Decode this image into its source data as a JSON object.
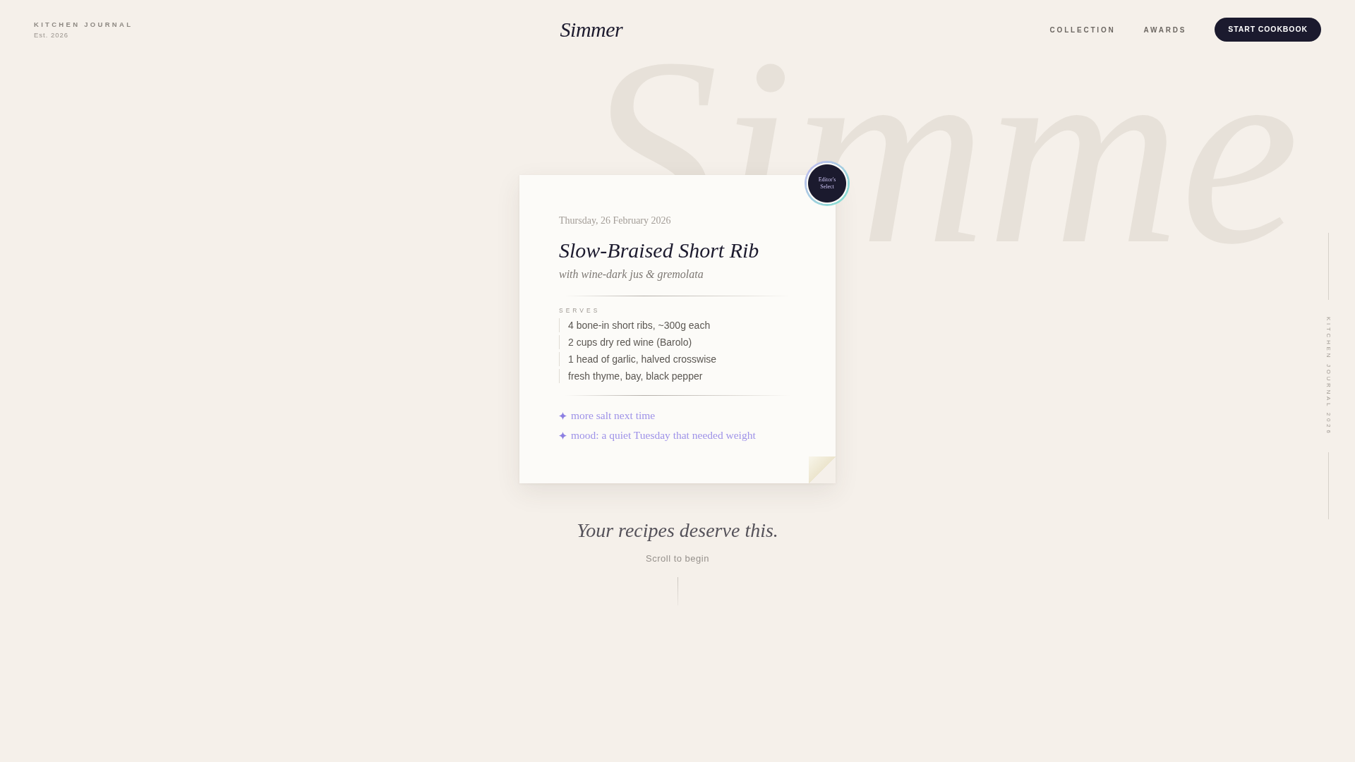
{
  "header": {
    "brand": "KITCHEN JOURNAL",
    "established": "Est. 2026",
    "logo": "Simmer",
    "nav": [
      "COLLECTION",
      "AWARDS"
    ],
    "cta": "START COOKBOOK"
  },
  "backdrop_word": "Simme",
  "card": {
    "badge": "Editor's Select",
    "date": "Thursday, 26 February 2026",
    "title": "Slow-Braised Short Rib",
    "subtitle": "with wine-dark jus & gremolata",
    "section_label": "SERVES",
    "ingredients": [
      "4 bone-in short ribs, ~300g each",
      "2 cups dry red wine (Barolo)",
      "1 head of garlic, halved crosswise",
      "fresh thyme, bay, black pepper"
    ],
    "notes": [
      "more salt next time",
      "mood: a quiet Tuesday that needed weight"
    ]
  },
  "tagline": "Your recipes deserve this.",
  "scroll_hint": "Scroll to begin",
  "side_label": "KITCHEN JOURNAL 2026"
}
